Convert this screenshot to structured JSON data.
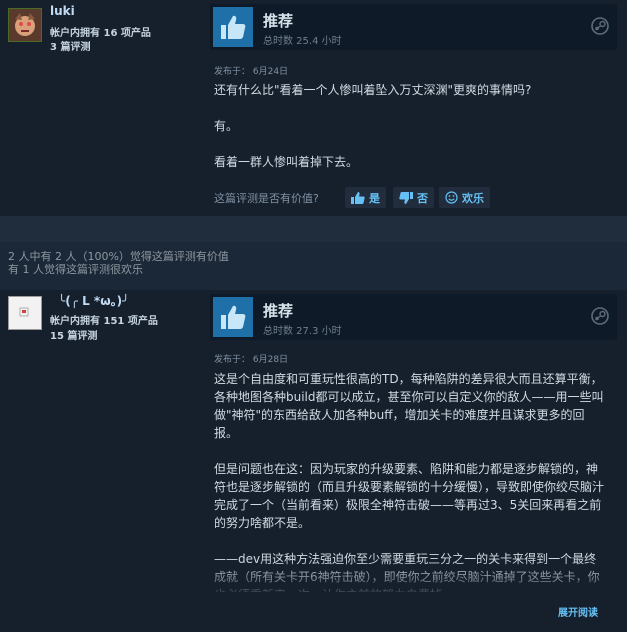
{
  "reviews": [
    {
      "author": "luki",
      "products": "帐户内拥有 16 项产品",
      "reviews_count": "3 篇评测",
      "vote": "推荐",
      "hours": "总时数 25.4 小时",
      "posted": "发布于：  6月24日",
      "paragraphs": [
        "还有什么比\"看着一个人惨叫着坠入万丈深渊\"更爽的事情吗?",
        "有。",
        "看着一群人惨叫着掉下去。"
      ],
      "helpful_question": "这篇评测是否有价值?",
      "yes_label": "是",
      "no_label": "否",
      "funny_label": "欢乐"
    },
    {
      "author": "╰(╭ L *ω。)╯",
      "products": "帐户内拥有 151 项产品",
      "reviews_count": "15 篇评测",
      "vote": "推荐",
      "hours": "总时数 27.3 小时",
      "posted": "发布于：  6月28日",
      "paragraphs": [
        "这是个自由度和可重玩性很高的TD，每种陷阱的差异很大而且还算平衡，各种地图各种build都可以成立，甚至你可以自定义你的敌人——用一些叫做\"神符\"的东西给敌人加各种buff，增加关卡的难度并且谋求更多的回报。",
        "但是问题也在这：因为玩家的升级要素、陷阱和能力都是逐步解锁的，神符也是逐步解锁的（而且升级要素解锁的十分缓慢），导致即使你绞尽脑汁完成了一个（当前看来）极限全神符击破——等再过3、5关回来再看之前的努力啥都不是。",
        "——dev用这种方法强迫你至少需要重玩三分之一的关卡来得到一个最终成就（所有关卡开6神符击破），即使你之前绞尽脑汁通掉了这些关卡，你也必须重新来一次，让你之前的努力白费掉。"
      ],
      "read_more": "展开阅读"
    }
  ],
  "helpful_summary": {
    "line1": "2 人中有 2 人（100%）觉得这篇评测有价值",
    "line2": "有 1 人觉得这篇评测很欢乐"
  }
}
